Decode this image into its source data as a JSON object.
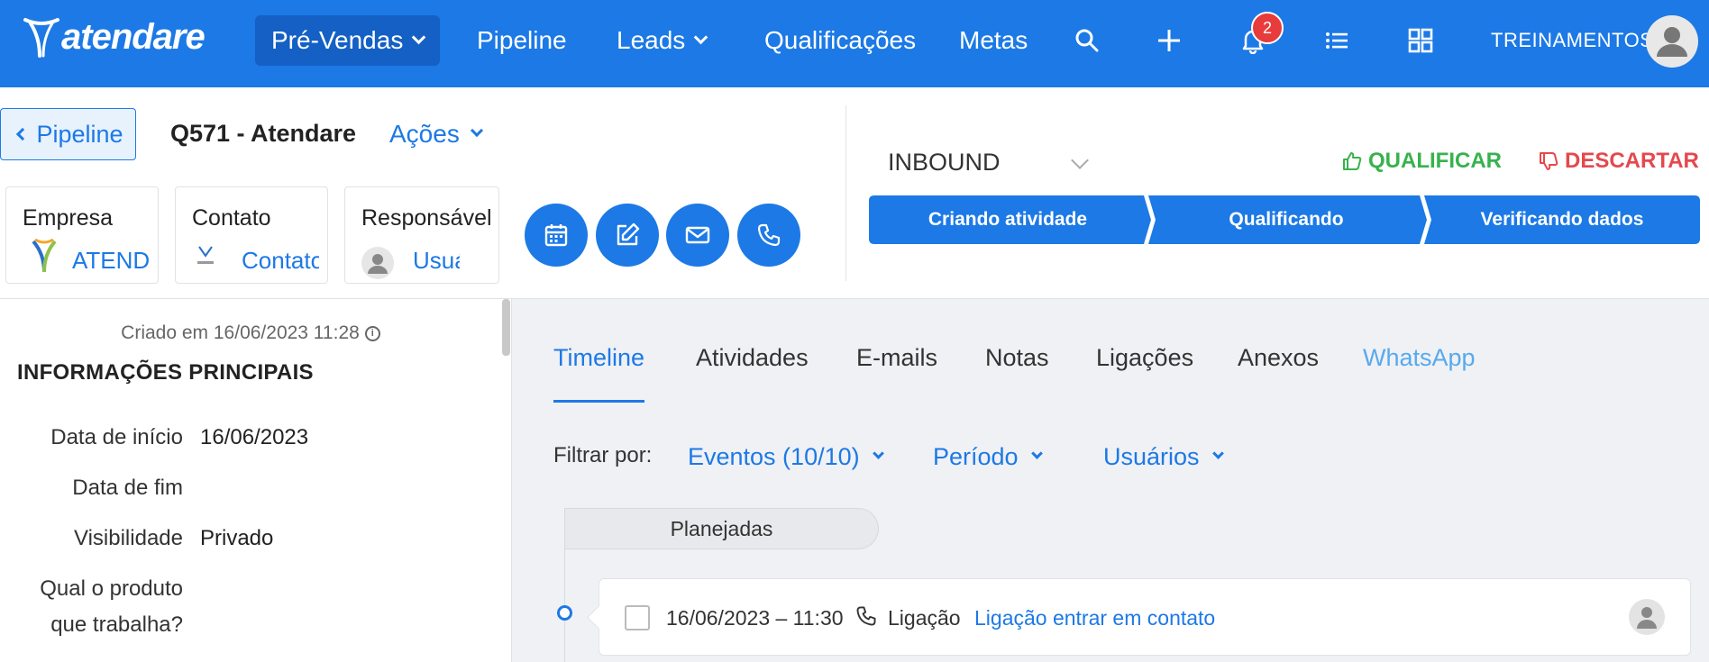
{
  "navbar": {
    "brand": "atendare",
    "items": [
      {
        "label": "Pré-Vendas"
      },
      {
        "label": "Pipeline"
      },
      {
        "label": "Leads"
      },
      {
        "label": "Qualificações"
      },
      {
        "label": "Metas"
      }
    ],
    "notification_count": "2",
    "user_name": "TREINAMENTOS",
    "icons": [
      "search-icon",
      "plus-icon",
      "bell-icon",
      "list-icon",
      "grid-icon",
      "user-avatar-icon"
    ]
  },
  "header": {
    "back_label": "Pipeline",
    "record_title": "Q571 - Atendare",
    "actions_label": "Ações",
    "cards": [
      {
        "title": "Empresa",
        "value": "ATENDARE"
      },
      {
        "title": "Contato",
        "value": "Contato"
      },
      {
        "title": "Responsável",
        "value": "Usuário"
      }
    ],
    "source": "INBOUND",
    "qualify_label": "QUALIFICAR",
    "discard_label": "DESCARTAR",
    "stages": [
      "Criando atividade",
      "Qualificando",
      "Verificando dados"
    ]
  },
  "left": {
    "created": "Criado em 16/06/2023 11:28",
    "section_title": "INFORMAÇÕES PRINCIPAIS",
    "fields": [
      {
        "label": "Data de início",
        "value": "16/06/2023"
      },
      {
        "label": "Data de fim",
        "value": ""
      },
      {
        "label": "Visibilidade",
        "value": "Privado"
      },
      {
        "label_line1": "Qual o produto",
        "label_line2": "que trabalha?",
        "value": ""
      }
    ]
  },
  "tabs": [
    "Timeline",
    "Atividades",
    "E-mails",
    "Notas",
    "Ligações",
    "Anexos",
    "WhatsApp"
  ],
  "filters": {
    "label": "Filtrar por:",
    "events": "Eventos (10/10)",
    "period": "Período",
    "users": "Usuários"
  },
  "timeline": {
    "group_label": "Planejadas",
    "event": {
      "datetime": "16/06/2023 – 11:30",
      "type": "Ligação",
      "title": "Ligação entrar em contato"
    }
  },
  "colors": {
    "primary": "#1c79e6",
    "qualify": "#37b24d",
    "discard": "#e5484d"
  }
}
